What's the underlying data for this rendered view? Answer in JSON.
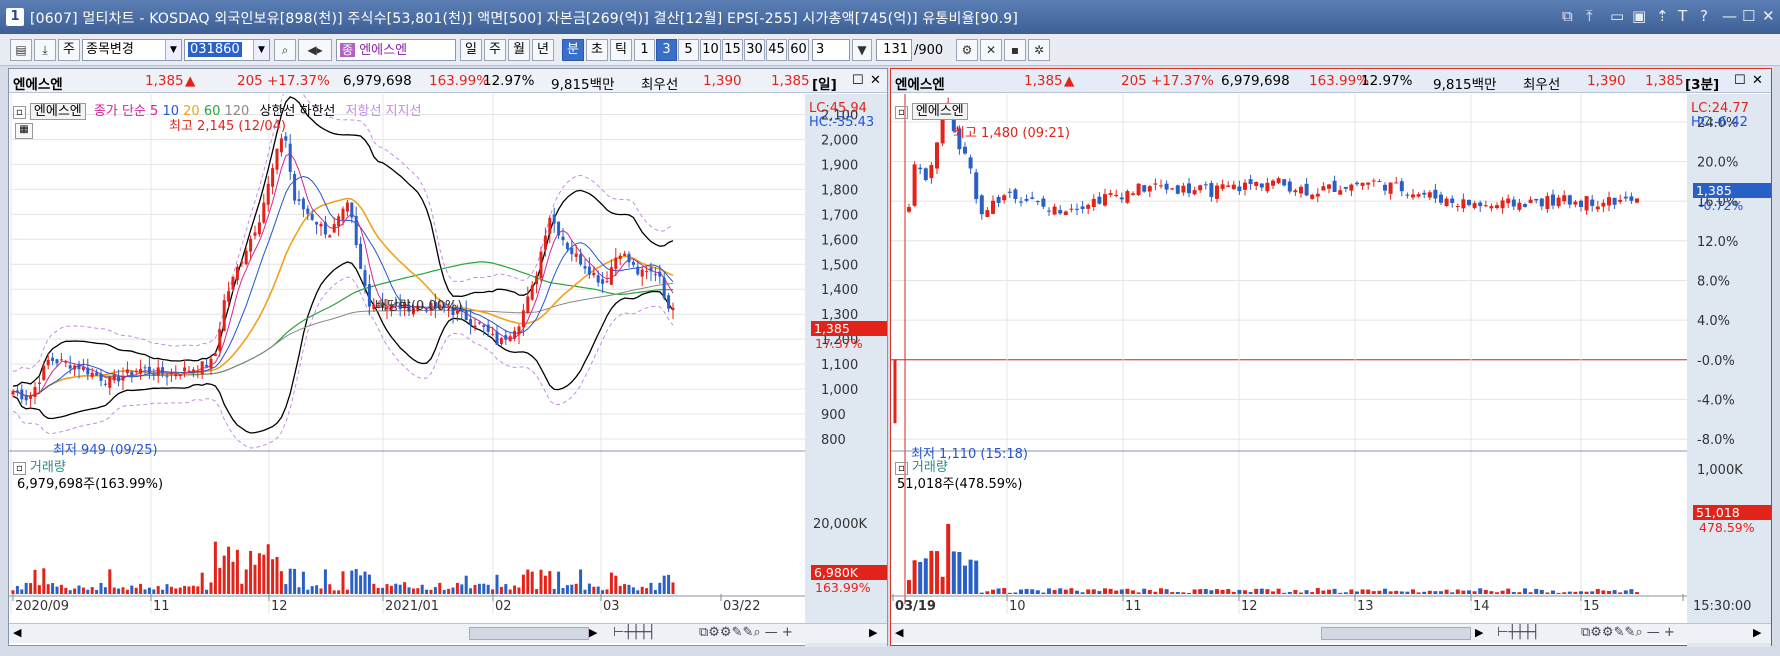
{
  "window": {
    "number": "1",
    "title": "[0607] 멀티차트 - KOSDAQ 외국인보유[898(천)] 주식수[53,801(천)] 액면[500] 자본금[269(억)] 결산[12월] EPS[-255] 시가총액[745(억)] 유통비율[90.9]"
  },
  "toolbar": {
    "main_label": "주",
    "stock_change": "종목변경",
    "code": "031860",
    "stock_name_badge": "종",
    "stock_name": "엔에스엔",
    "period_buttons": [
      "일",
      "주",
      "월",
      "년",
      "분",
      "초",
      "틱"
    ],
    "selected_period": "분",
    "interval_buttons": [
      "1",
      "3",
      "5",
      "10",
      "15",
      "30",
      "45",
      "60"
    ],
    "selected_interval": "3",
    "interval_value": "3",
    "count_value": "131",
    "count_max": "/900"
  },
  "left_panel": {
    "header": {
      "name": "엔에스엔",
      "price": "1,385",
      "arrow": "▲",
      "change": "205",
      "change_pct": "+17.37%",
      "volume": "6,979,698",
      "vol_ratio": "163.99%",
      "turnover": "12.97%",
      "amount": "9,815백만",
      "quote_label": "최우선",
      "ask": "1,390",
      "bid": "1,385",
      "period": "[일]"
    },
    "legend": {
      "name": "엔에스엔",
      "close_label": "종가 단순",
      "ma": [
        "5",
        "10",
        "20",
        "60",
        "120"
      ],
      "upper": "상한선",
      "lower": "하한선",
      "resist": "저항선",
      "support": "지지선"
    },
    "lc": "LC:45.94",
    "hc": "HC:-35.43",
    "high_note": "최고 2,145 (12/04)",
    "low_note": "최저 949 (09/25)",
    "dividend_note": "배당락(0.00%)",
    "price_badge": "1,385",
    "pct_badge": "17.37%",
    "volume_title": "거래량",
    "volume_value": "6,979,698주(163.99%)",
    "volume_axis_top": "20,000K",
    "volume_badge": "6,980K",
    "volume_pct_badge": "163.99%"
  },
  "right_panel": {
    "header": {
      "name": "엔에스엔",
      "price": "1,385",
      "arrow": "▲",
      "change": "205",
      "change_pct": "+17.37%",
      "volume": "6,979,698",
      "vol_ratio": "163.99%",
      "turnover": "12.97%",
      "amount": "9,815백만",
      "quote_label": "최우선",
      "ask": "1,390",
      "bid": "1,385",
      "period": "[3분]"
    },
    "legend_name": "엔에스엔",
    "lc": "LC:24.77",
    "hc": "HC:-6.42",
    "high_note": "최고 1,480 (09:21)",
    "low_note": "최저 1,110 (15:18)",
    "price_badge": "1,385",
    "pct_badge": "-0.72%",
    "volume_title": "거래량",
    "volume_value": "51,018주(478.59%)",
    "volume_axis_top": "1,000K",
    "volume_badge": "51,018",
    "volume_pct_badge": "478.59%"
  },
  "chart_data": [
    {
      "type": "candlestick",
      "title": "",
      "ylabels": [
        "2,100",
        "2,000",
        "1,900",
        "1,800",
        "1,700",
        "1,600",
        "1,500",
        "1,400",
        "1,300",
        "1,200",
        "1,100",
        "1,000",
        "900",
        "800"
      ],
      "ylim": [
        760,
        2150
      ],
      "xlabels": [
        "2020/09",
        "11",
        "12",
        "2021/01",
        "02",
        "03",
        "03/22"
      ],
      "volume_max": 20000000,
      "last_close": 1385
    },
    {
      "type": "candlestick",
      "title": "",
      "ylabels": [
        "24.0%",
        "20.0%",
        "16.0%",
        "12.0%",
        "8.0%",
        "4.0%",
        "-0.0%",
        "-4.0%",
        "-8.0%"
      ],
      "ylim": [
        -9,
        26
      ],
      "xlabels": [
        "03/19",
        "10",
        "11",
        "12",
        "13",
        "14",
        "15",
        "15:30:00"
      ],
      "volume_max": 1000000,
      "last_close_pct": -0.72
    }
  ],
  "colors": {
    "up": "#e2231a",
    "down": "#2860c8",
    "ma5": "#d6249a",
    "ma10": "#2255d4",
    "ma20": "#f0a21e",
    "ma60": "#29a33c",
    "ma120": "#888888",
    "band": "#000000",
    "envelope": "#c58ce6"
  }
}
